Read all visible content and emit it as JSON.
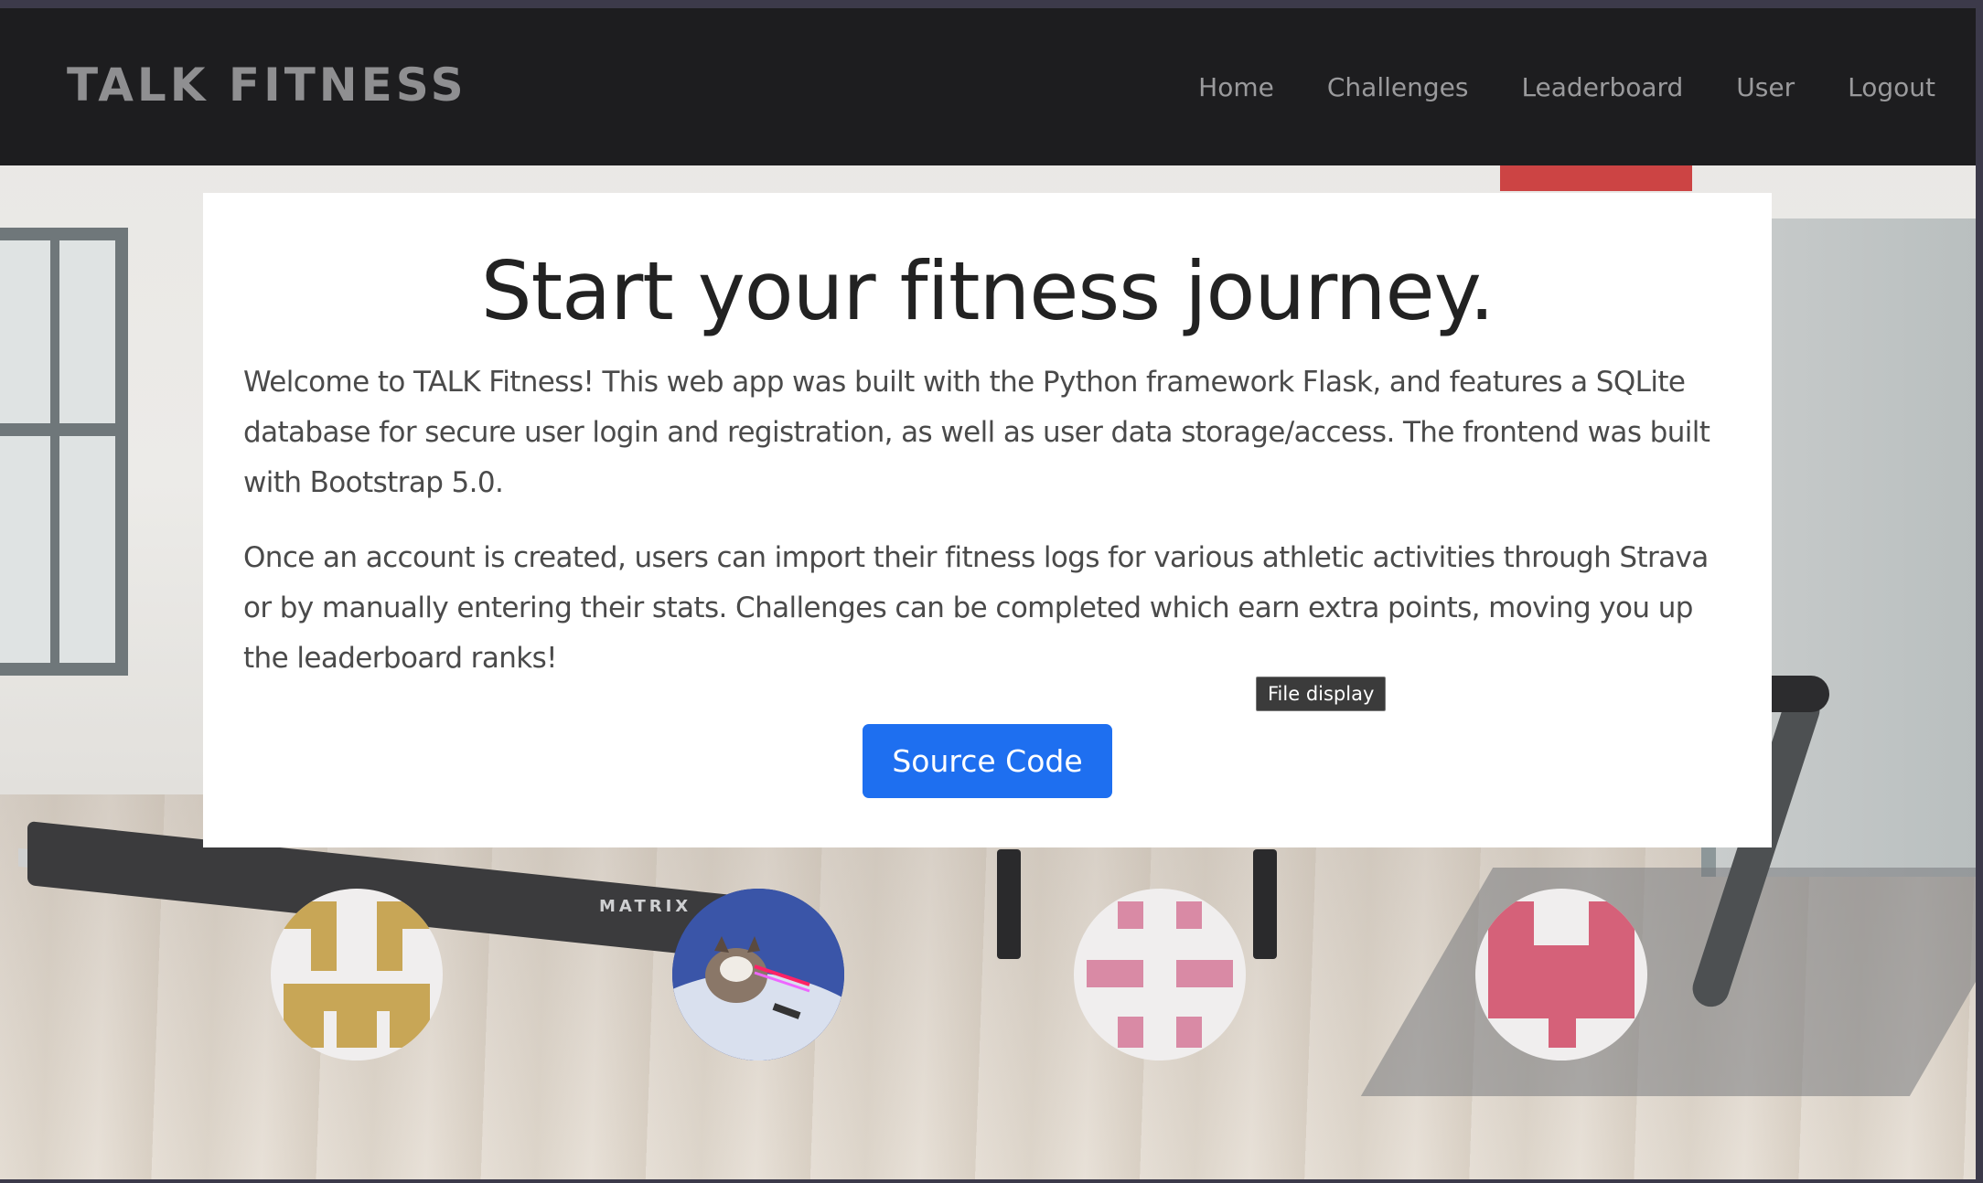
{
  "navbar": {
    "brand": "TALK FITNESS",
    "links": [
      "Home",
      "Challenges",
      "Leaderboard",
      "User",
      "Logout"
    ]
  },
  "hero": {
    "title": "Start your fitness journey.",
    "paragraph1": "Welcome to TALK Fitness! This web app was built with the Python framework Flask, and features a SQLite database for secure user login and registration, as well as user data storage/access. The frontend was built with Bootstrap 5.0.",
    "paragraph2": "Once an account is created, users can import their fitness logs for various athletic activities through Strava or by manually entering their stats. Challenges can be completed which earn extra points, moving you up the leaderboard ranks!",
    "button_label": "Source Code"
  },
  "tooltip": "File display",
  "background_text": "MATRIX",
  "colors": {
    "navbar_bg": "#1d1d1f",
    "button_bg": "#1e6ff0",
    "avatar1": "#c8a656",
    "avatar3": "#d98aa5",
    "avatar4": "#d56179"
  }
}
